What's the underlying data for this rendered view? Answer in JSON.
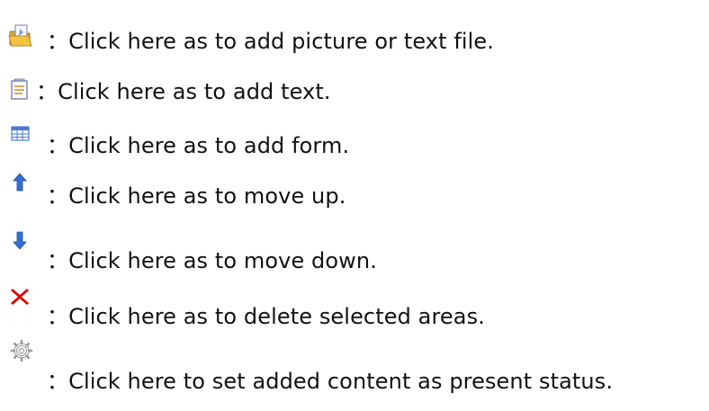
{
  "items": [
    {
      "icon": "open-folder-icon",
      "text": "：Click here as to add picture or text file."
    },
    {
      "icon": "text-document-icon",
      "text": "：Click here as to add text."
    },
    {
      "icon": "table-form-icon",
      "text": "：Click here as to add form."
    },
    {
      "icon": "arrow-up-icon",
      "text": "：Click here as to move up."
    },
    {
      "icon": "arrow-down-icon",
      "text": "：Click here as to move down."
    },
    {
      "icon": "delete-x-icon",
      "text": "：Click here as to delete selected areas."
    },
    {
      "icon": "gear-icon",
      "text": "：Click here to set added content as present status."
    }
  ],
  "colors": {
    "text": "#111111",
    "arrow_blue": "#2f6fd6",
    "delete_red": "#e00000",
    "folder_yellow": "#f3c343"
  }
}
